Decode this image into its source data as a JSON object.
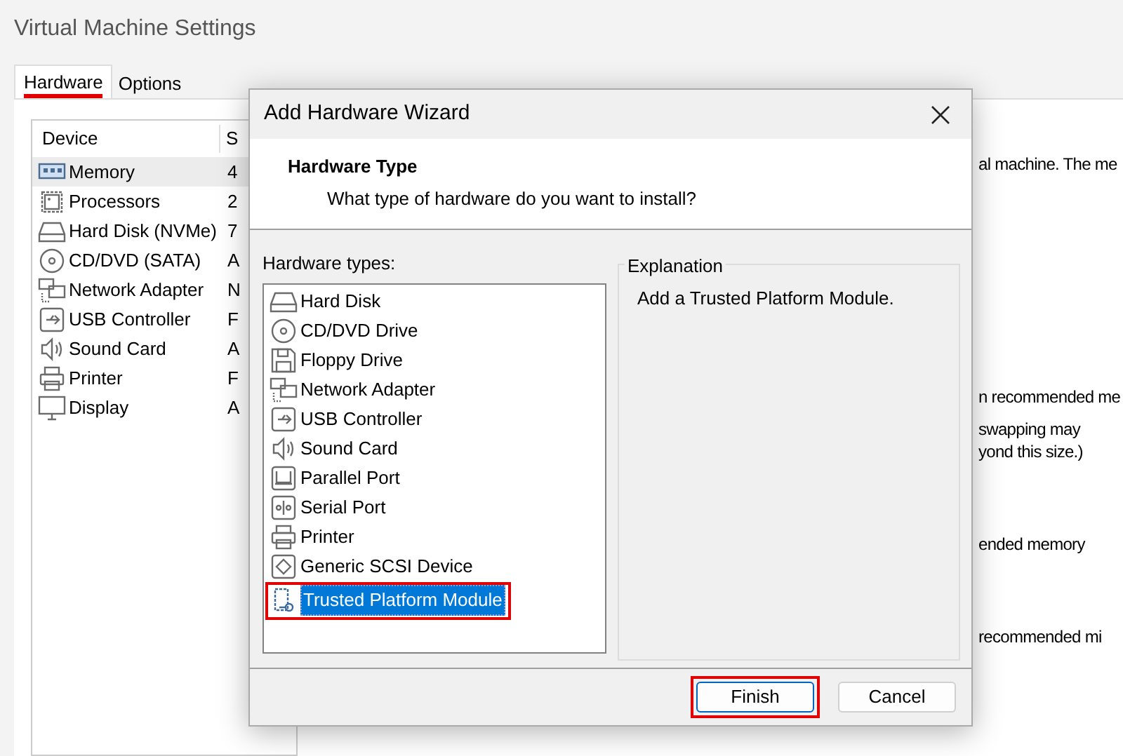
{
  "window": {
    "title": "Virtual Machine Settings"
  },
  "tabs": [
    {
      "label": "Hardware",
      "selected": true
    },
    {
      "label": "Options",
      "selected": false
    }
  ],
  "device_table": {
    "columns": [
      "Device",
      "S"
    ],
    "rows": [
      {
        "kind": "memory",
        "device": "Memory",
        "summary": "4",
        "selected": true
      },
      {
        "kind": "processor",
        "device": "Processors",
        "summary": "2",
        "selected": false
      },
      {
        "kind": "disk",
        "device": "Hard Disk (NVMe)",
        "summary": "7",
        "selected": false
      },
      {
        "kind": "cd",
        "device": "CD/DVD (SATA)",
        "summary": "A",
        "selected": false
      },
      {
        "kind": "network",
        "device": "Network Adapter",
        "summary": "N",
        "selected": false
      },
      {
        "kind": "usb",
        "device": "USB Controller",
        "summary": "F",
        "selected": false
      },
      {
        "kind": "sound",
        "device": "Sound Card",
        "summary": "A",
        "selected": false
      },
      {
        "kind": "printer",
        "device": "Printer",
        "summary": "F",
        "selected": false
      },
      {
        "kind": "display",
        "device": "Display",
        "summary": "A",
        "selected": false
      }
    ]
  },
  "background_texts": [
    "al machine. The me",
    "n recommended me",
    "swapping may",
    "yond this size.)",
    "ended memory",
    "recommended mi"
  ],
  "dialog": {
    "title": "Add Hardware Wizard",
    "heading": "Hardware Type",
    "subtitle": "What type of hardware do you want to install?",
    "list_label": "Hardware types:",
    "hardware_types": [
      {
        "kind": "disk",
        "label": "Hard Disk",
        "selected": false
      },
      {
        "kind": "cd",
        "label": "CD/DVD Drive",
        "selected": false
      },
      {
        "kind": "floppy",
        "label": "Floppy Drive",
        "selected": false
      },
      {
        "kind": "network",
        "label": "Network Adapter",
        "selected": false
      },
      {
        "kind": "usb",
        "label": "USB Controller",
        "selected": false
      },
      {
        "kind": "sound",
        "label": "Sound Card",
        "selected": false
      },
      {
        "kind": "parallel",
        "label": "Parallel Port",
        "selected": false
      },
      {
        "kind": "serial",
        "label": "Serial Port",
        "selected": false
      },
      {
        "kind": "printer",
        "label": "Printer",
        "selected": false
      },
      {
        "kind": "scsi",
        "label": "Generic SCSI Device",
        "selected": false
      },
      {
        "kind": "tpm",
        "label": "Trusted Platform Module",
        "selected": true
      }
    ],
    "explanation_title": "Explanation",
    "explanation": "Add a Trusted Platform Module.",
    "buttons": [
      {
        "label": "Finish",
        "default": true
      },
      {
        "label": "Cancel",
        "default": false
      }
    ]
  }
}
